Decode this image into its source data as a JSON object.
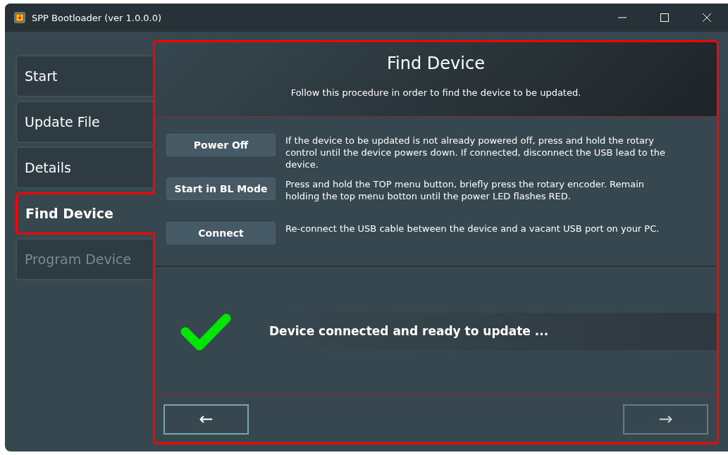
{
  "window": {
    "title": "SPP Bootloader (ver 1.0.0.0)"
  },
  "sidebar": {
    "items": [
      {
        "label": "Start",
        "selected": false,
        "disabled": false
      },
      {
        "label": "Update File",
        "selected": false,
        "disabled": false
      },
      {
        "label": "Details",
        "selected": false,
        "disabled": false
      },
      {
        "label": "Find Device",
        "selected": true,
        "disabled": false
      },
      {
        "label": "Program Device",
        "selected": false,
        "disabled": true
      }
    ]
  },
  "header": {
    "title": "Find Device",
    "subtitle": "Follow this procedure in order to find the device to be updated."
  },
  "steps": [
    {
      "button": "Power Off",
      "text": "If the device to be updated is not already powered off, press and hold the rotary control until the device powers down. If connected, disconnect the USB lead to the device."
    },
    {
      "button": "Start in BL Mode",
      "text": "Press and hold the TOP menu button, briefly press the rotary encoder. Remain holding the top menu botton until the power LED flashes RED."
    },
    {
      "button": "Connect",
      "text": "Re-connect the USB cable between the device and a vacant USB port on your PC."
    }
  ],
  "status": {
    "connected": true,
    "message": "Device connected and ready to update ..."
  },
  "footer": {
    "back": {
      "label": "←",
      "disabled": false
    },
    "next": {
      "label": "→",
      "disabled": true
    }
  }
}
